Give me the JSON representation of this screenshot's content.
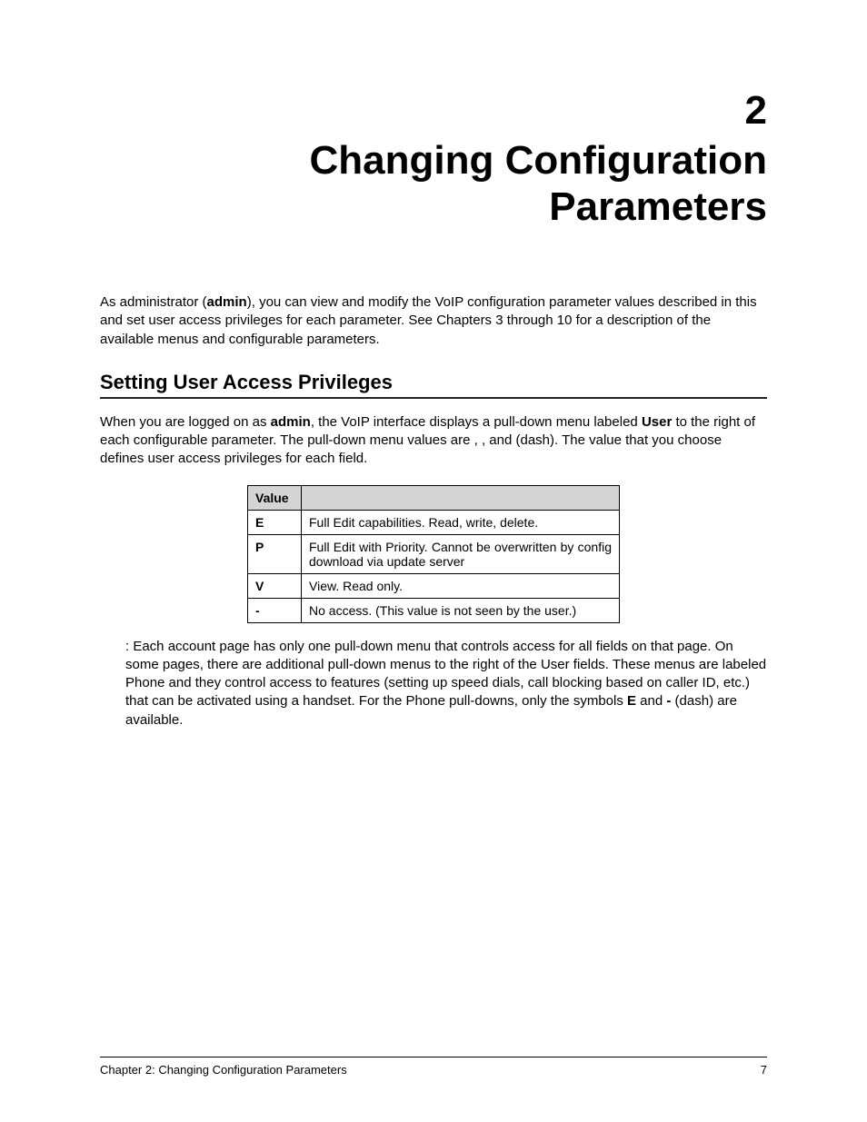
{
  "chapter": {
    "number": "2",
    "title_line1": "Changing Configuration",
    "title_line2": "Parameters"
  },
  "intro": {
    "p1_pre": "As administrator (",
    "p1_admin": "admin",
    "p1_post": "), you can view and modify the VoIP configuration parameter values described in this ",
    "p1_tail": " and set user access privileges for each parameter. See Chapters 3 through 10 for a description of the available menus and configurable parameters."
  },
  "section1": {
    "title": "Setting User Access Privileges",
    "p1_pre": "When you are logged on as ",
    "p1_admin": "admin",
    "p1_mid": ", the VoIP interface displays a pull-down menu labeled ",
    "p1_user": "User",
    "p1_post": " to the right of each configurable parameter. The pull-down menu values are   ,   ,    and   (dash). The value that you choose defines user access privileges for each field."
  },
  "table": {
    "header_value": "Value",
    "header_desc": "",
    "rows": [
      {
        "value": "E",
        "desc": "Full Edit capabilities. Read, write, delete."
      },
      {
        "value": "P",
        "desc": "Full Edit with Priority. Cannot be overwritten by config download via update server"
      },
      {
        "value": "V",
        "desc": "View. Read only."
      },
      {
        "value": "-",
        "desc": "No access. (This value is not seen by the user.)"
      }
    ]
  },
  "note": {
    "pre": ": Each account page has only one pull-down menu that controls access for all fields on that page. On some pages, there are additional pull-down menus to the right of the User fields. These menus are labeled Phone and they control access to features (setting up speed dials, call blocking based on caller ID, etc.) that can be activated using a handset. For the Phone pull-downs, only the symbols ",
    "sym_e": "E",
    "mid": " and ",
    "sym_dash": "-",
    "post": " (dash) are available."
  },
  "footer": {
    "left": "Chapter 2: Changing Configuration Parameters",
    "right": "7"
  }
}
